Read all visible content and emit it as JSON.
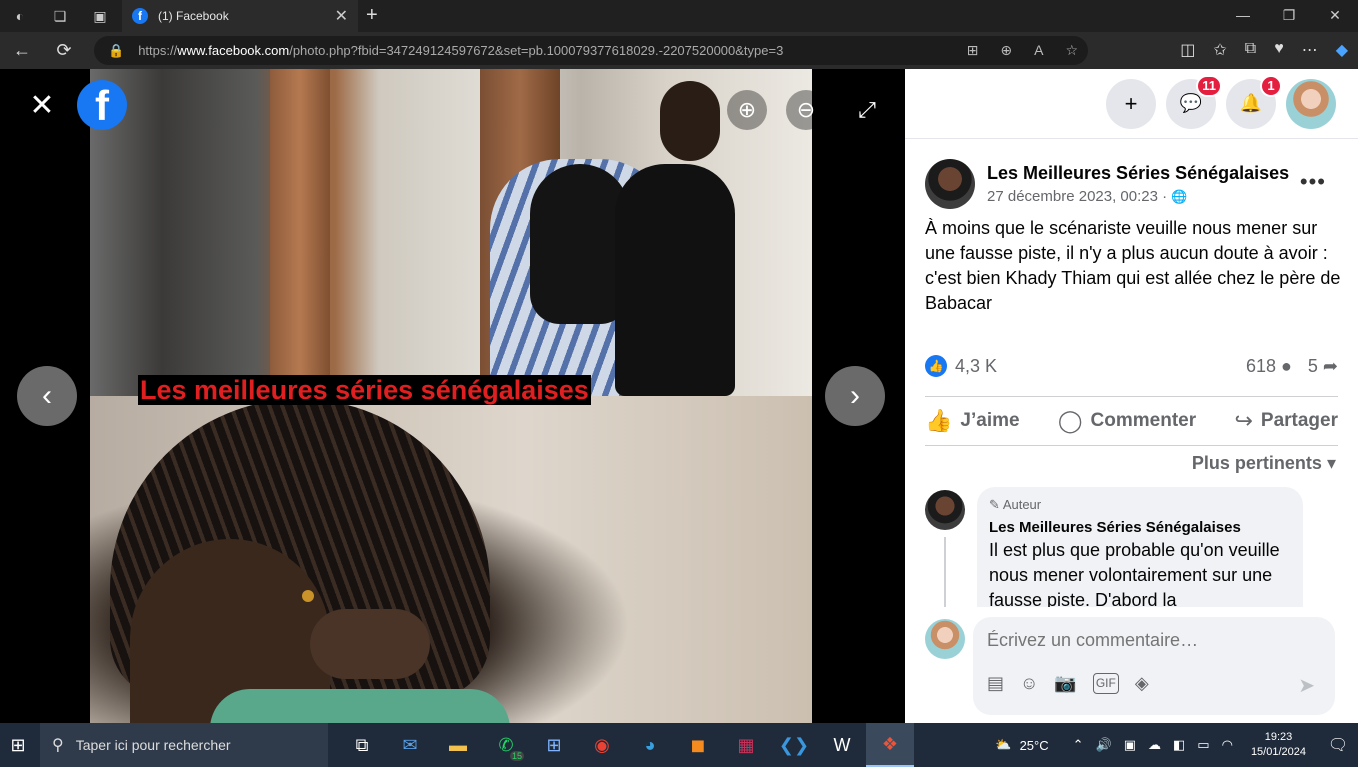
{
  "browser": {
    "tab_title": "(1) Facebook",
    "tab_close": "✕",
    "new_tab": "+",
    "favicon": "f",
    "url_prefix": "https://",
    "url_host": "www.facebook.com",
    "url_path": "/photo.php?fbid=347249124597672&set=pb.100079377618029.-2207520000&type=3",
    "window_controls": [
      "—",
      "❐",
      "✕"
    ]
  },
  "viewer": {
    "caption": "Les meilleures séries sénégalaises",
    "close": "✕",
    "logo": "f",
    "prev": "‹",
    "next": "›",
    "zoom_in": "⊕",
    "zoom_out": "⊖",
    "fullscreen": "⤢"
  },
  "header": {
    "create": "+",
    "messenger_badge": "11",
    "notifications_badge": "1"
  },
  "post": {
    "page_name": "Les Meilleures Séries Sénégalaises",
    "date": "27 décembre 2023, 00:23 · ",
    "privacy_icon": "🌐",
    "more": "•••",
    "text": "À moins que le scénariste veuille nous mener sur une fausse piste, il n'y a plus aucun doute à avoir : c'est bien Khady Thiam qui est allée chez le père de Babacar",
    "likes": "4,3 K",
    "comments": "618",
    "shares": "5"
  },
  "actions": {
    "like": "J’aime",
    "comment": "Commenter",
    "share": "Partager"
  },
  "comments": {
    "sort_label": "Plus pertinents",
    "sort_caret": "▾",
    "first": {
      "author_tag": "Auteur",
      "name": "Les Meilleures Séries Sénégalaises",
      "text": "Il est plus que probable qu'on veuille nous mener volontairement sur une fausse piste. D'abord la"
    },
    "composer_placeholder": "Écrivez un commentaire…",
    "composer_tools": [
      "▤",
      "☺",
      "📷",
      "GIF",
      "◈"
    ],
    "send": "➤"
  },
  "taskbar": {
    "search_placeholder": "Taper ici pour rechercher",
    "whatsapp_count": "15",
    "temperature": "25°C",
    "time": "19:23",
    "date": "15/01/2024"
  },
  "icons": {
    "back": "←",
    "refresh": "⟳",
    "lock": "🔒",
    "like": "👍",
    "comment": "◯",
    "share": "↪",
    "bell": "🔔",
    "messenger": "💬",
    "start": "⊞",
    "search": "⚲"
  },
  "colors": {
    "facebook_blue": "#1877f2",
    "badge_red": "#e41e3f",
    "caption_red": "#e02020"
  }
}
